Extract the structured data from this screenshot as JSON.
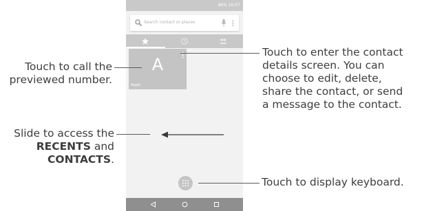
{
  "phone": {
    "status_bar": {
      "text": "96% 10:07"
    },
    "search": {
      "placeholder": "Search contact or places"
    },
    "tabs": [
      {
        "icon": "star-icon"
      },
      {
        "icon": "clock-icon"
      },
      {
        "icon": "people-icon"
      }
    ],
    "contact": {
      "letter": "A",
      "name": "Apple"
    },
    "navigation": {
      "back": "back-icon",
      "home": "home-icon",
      "recents": "overview-icon"
    }
  },
  "captions": {
    "call": "Touch to call the previewed number.",
    "slide_prefix": "Slide to access the",
    "slide_recents": "RECENTS",
    "slide_and": "and",
    "slide_contacts": "CONTACTS",
    "slide_period": ".",
    "details": "Touch to enter the contact details screen. You can choose to edit, delete, share the contact, or send a message to the contact.",
    "keyboard": "Touch to display keyboard."
  },
  "colors": {
    "status_bar": "#c9c9c9",
    "tab_bar": "#c8c8c8",
    "tile": "#c4c4c4",
    "navigation_bar": "#8f8f8f",
    "screen": "#f2f2f2",
    "text": "#3d3d3d"
  }
}
